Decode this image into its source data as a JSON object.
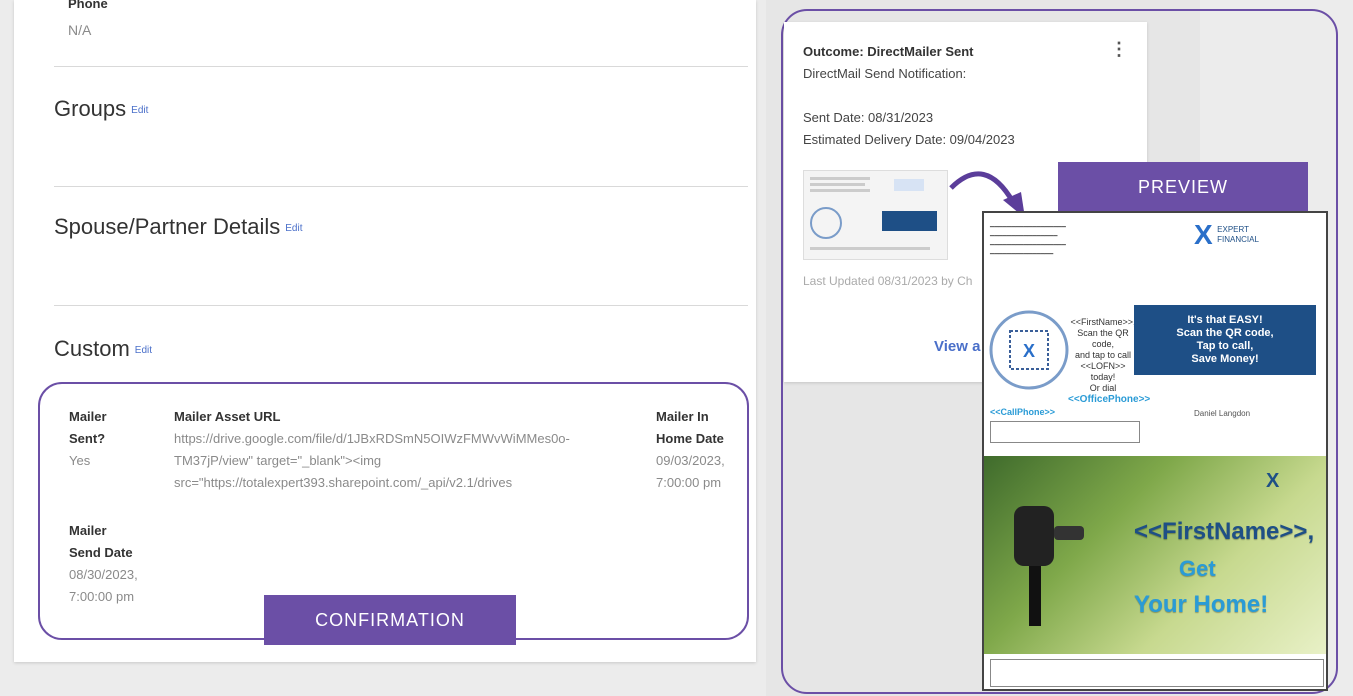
{
  "contact": {
    "phone_label": "Phone",
    "phone_value": "N/A"
  },
  "sections": {
    "groups_title": "Groups",
    "spouse_title": "Spouse/Partner Details",
    "custom_title": "Custom",
    "edit_label": "Edit"
  },
  "custom_fields": {
    "mailer_sent_label_1": "Mailer",
    "mailer_sent_label_2": "Sent?",
    "mailer_sent_value": "Yes",
    "asset_url_label": "Mailer Asset URL",
    "asset_url_line1": "https://drive.google.com/file/d/1JBxRDSmN5OIWzFMWvWiMMes0o-",
    "asset_url_line2": "TM37jP/view\" target=\"_blank\"><img",
    "asset_url_line3": "src=\"https://totalexpert393.sharepoint.com/_api/v2.1/drives",
    "in_home_label_1": "Mailer In",
    "in_home_label_2": "Home Date",
    "in_home_value_1": "09/03/2023,",
    "in_home_value_2": "7:00:00 pm",
    "send_date_label_1": "Mailer",
    "send_date_label_2": "Send Date",
    "send_date_value_1": "08/30/2023,",
    "send_date_value_2": "7:00:00 pm"
  },
  "tags": {
    "confirmation": "CONFIRMATION",
    "preview": "PREVIEW"
  },
  "activity": {
    "title": "Outcome: DirectMailer Sent",
    "subtitle": "DirectMail Send Notification:",
    "sent_date": "Sent Date: 08/31/2023",
    "delivery_date": "Estimated Delivery Date: 09/04/2023",
    "last_updated": "Last Updated 08/31/2023 by Ch",
    "view_link": "View a",
    "kebab": "⋮"
  },
  "preview_doc": {
    "logo_line1": "EXPERT",
    "logo_line2": "FINANCIAL",
    "qr_text_1": "<<FirstName>>,",
    "qr_text_2": "Scan the QR code,",
    "qr_text_3": "and tap to call",
    "qr_text_4": "<<LOFN>> today!",
    "qr_text_5": "Or dial",
    "qr_text_6": "<<OfficePhone>>",
    "banner_1": "It's that EASY!",
    "banner_2": "Scan the QR code,",
    "banner_3": "Tap to call,",
    "banner_4": "Save Money!",
    "call_phone": "<<CallPhone>>",
    "addressee": "Daniel Langdon",
    "photo_name": "<<FirstName>>,",
    "photo_get": "Get",
    "photo_home": "Your Home!"
  },
  "colors": {
    "accent_purple": "#6b4fa6",
    "link_blue": "#4a6fc9",
    "banner_navy": "#1e4f86"
  }
}
